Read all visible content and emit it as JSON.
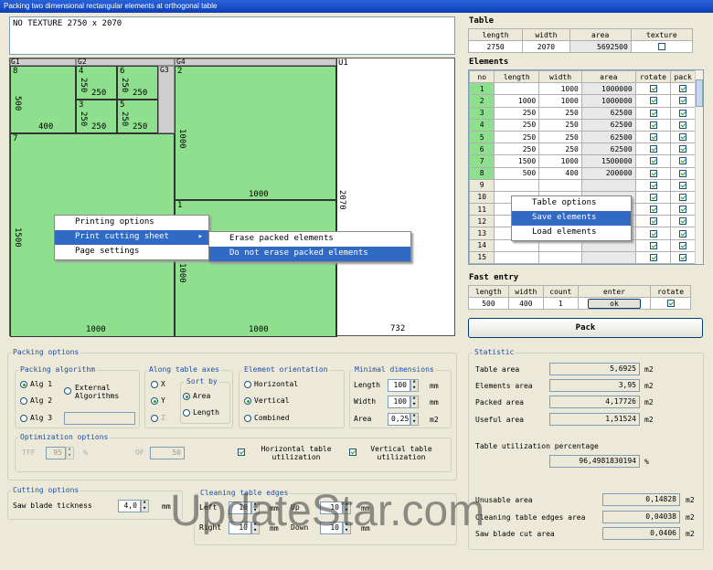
{
  "window": {
    "title": "Packing two dimensional rectangular elements at orthogonal table"
  },
  "notes": {
    "text": "NO TEXTURE 2750 x 2070"
  },
  "table_panel": {
    "title": "Table",
    "headers": [
      "length",
      "width",
      "area",
      "texture"
    ],
    "row": {
      "length": "2750",
      "width": "2070",
      "area": "5692500",
      "texture": false
    }
  },
  "elements_panel": {
    "title": "Elements",
    "headers": [
      "no",
      "length",
      "width",
      "area",
      "rotate",
      "pack"
    ],
    "rows": [
      {
        "no": "1",
        "length": "",
        "width": "1000",
        "area": "1000000",
        "rotate": true,
        "pack": true,
        "green": true
      },
      {
        "no": "2",
        "length": "1000",
        "width": "1000",
        "area": "1000000",
        "rotate": true,
        "pack": true,
        "green": true
      },
      {
        "no": "3",
        "length": "250",
        "width": "250",
        "area": "62500",
        "rotate": true,
        "pack": true,
        "green": true
      },
      {
        "no": "4",
        "length": "250",
        "width": "250",
        "area": "62500",
        "rotate": true,
        "pack": true,
        "green": true
      },
      {
        "no": "5",
        "length": "250",
        "width": "250",
        "area": "62500",
        "rotate": true,
        "pack": true,
        "green": true
      },
      {
        "no": "6",
        "length": "250",
        "width": "250",
        "area": "62500",
        "rotate": true,
        "pack": true,
        "green": true
      },
      {
        "no": "7",
        "length": "1500",
        "width": "1000",
        "area": "1500000",
        "rotate": true,
        "pack": true,
        "green": true
      },
      {
        "no": "8",
        "length": "500",
        "width": "400",
        "area": "200000",
        "rotate": true,
        "pack": true,
        "green": true
      },
      {
        "no": "9",
        "length": "",
        "width": "",
        "area": "",
        "rotate": true,
        "pack": true,
        "green": false
      },
      {
        "no": "10",
        "length": "",
        "width": "",
        "area": "",
        "rotate": true,
        "pack": true,
        "green": false
      },
      {
        "no": "11",
        "length": "",
        "width": "",
        "area": "",
        "rotate": true,
        "pack": true,
        "green": false
      },
      {
        "no": "12",
        "length": "",
        "width": "",
        "area": "",
        "rotate": true,
        "pack": true,
        "green": false
      },
      {
        "no": "13",
        "length": "",
        "width": "",
        "area": "",
        "rotate": true,
        "pack": true,
        "green": false
      },
      {
        "no": "14",
        "length": "",
        "width": "",
        "area": "",
        "rotate": true,
        "pack": true,
        "green": false
      },
      {
        "no": "15",
        "length": "",
        "width": "",
        "area": "",
        "rotate": true,
        "pack": true,
        "green": false
      }
    ]
  },
  "table_menu": {
    "items": [
      "Table options",
      "Save elements",
      "Load elements"
    ],
    "selected": 1
  },
  "fast_entry": {
    "title": "Fast entry",
    "headers": [
      "length",
      "width",
      "count",
      "enter",
      "rotate"
    ],
    "length": "500",
    "width": "400",
    "count": "1",
    "enter": "ok",
    "rotate": true
  },
  "pack_button": "Pack",
  "sheet": {
    "labels": {
      "g1": "G1",
      "g2": "G2",
      "g3": "G3",
      "g4": "G4",
      "u1": "U1"
    },
    "pieces": {
      "p8": {
        "no": "8",
        "w": "400",
        "h": "500"
      },
      "p4": {
        "no": "4",
        "w": "250",
        "h": "250"
      },
      "p3": {
        "no": "3",
        "w": "250",
        "h": "250"
      },
      "p6": {
        "no": "6",
        "w": "250",
        "h": "250"
      },
      "p5": {
        "no": "5",
        "w": "250",
        "h": "250"
      },
      "p2": {
        "no": "2",
        "w": "1000",
        "h": "1000"
      },
      "p7": {
        "no": "7",
        "w": "1000",
        "h": "1500"
      },
      "p1": {
        "no": "1",
        "w": "1000",
        "h": "1000"
      }
    },
    "dims": {
      "height": "2070",
      "bottom_rest": "732"
    }
  },
  "context_menu": {
    "items": [
      "Printing options",
      "Print cutting sheet",
      "Page settings"
    ],
    "selected": 1,
    "arrow": "▸"
  },
  "sub_menu": {
    "items": [
      "Erase packed elements",
      "Do not erase packed elements"
    ],
    "selected": 1
  },
  "packing_options": {
    "title": "Packing options",
    "algorithm": {
      "title": "Packing algorithm",
      "alg1": "Alg 1",
      "alg2": "Alg 2",
      "alg3": "Alg 3",
      "external": "External Algorithms",
      "selected": "alg1"
    },
    "axes": {
      "title": "Along table axes",
      "x": "X",
      "y": "Y",
      "z": "Z",
      "selected": "y",
      "sort_title": "Sort by",
      "area": "Area",
      "length": "Length",
      "sort_selected": "area"
    },
    "orientation": {
      "title": "Element orientation",
      "horizontal": "Horizontal",
      "vertical": "Vertical",
      "combined": "Combined",
      "selected": "vertical"
    },
    "minimal": {
      "title": "Minimal dimensions",
      "length_label": "Length",
      "length": "100",
      "width_label": "Width",
      "width": "100",
      "area_label": "Area",
      "area": "0,25",
      "unit_mm": "mm",
      "unit_m2": "m2"
    },
    "optimization": {
      "title": "Optimization options",
      "tff_label": "TFF",
      "tff": "95",
      "pct": "%",
      "of_label": "OF",
      "of": "50",
      "htu": "Horizontal table utilization",
      "vtu": "Vertical table utilization",
      "htu_on": true,
      "vtu_on": true
    }
  },
  "cutting_options": {
    "title": "Cutting options",
    "saw_label": "Saw blade tickness",
    "saw": "4,0",
    "unit": "mm"
  },
  "cleaning": {
    "title": "Cleaning table edges",
    "left_label": "Left",
    "left": "10",
    "right_label": "Right",
    "right": "10",
    "up_label": "Up",
    "up": "10",
    "down_label": "Down",
    "down": "10",
    "unit": "mm"
  },
  "statistic": {
    "title": "Statistic",
    "table_area_label": "Table area",
    "table_area": "5,6925",
    "elements_area_label": "Elements area",
    "elements_area": "3,95",
    "packed_area_label": "Packed area",
    "packed_area": "4,17726",
    "useful_area_label": "Useful area",
    "useful_area": "1,51524",
    "unit": "m2",
    "util_label": "Table utilization percentage",
    "util": "96,4981830194",
    "pct": "%",
    "unusable_label": "Unusable area",
    "unusable": "0,14828",
    "cleaning_label": "Cleaning table edges area",
    "cleaning": "0,04038",
    "saw_label": "Saw blade cut area",
    "saw": "0,0406"
  },
  "watermark": "UpdateStar.com"
}
